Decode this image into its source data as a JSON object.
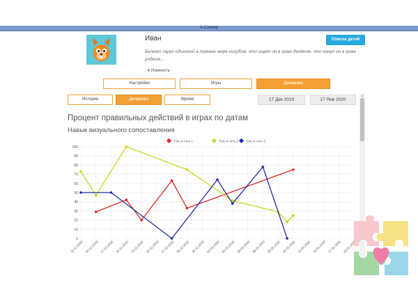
{
  "window": {
    "title": "А-Спикер"
  },
  "profile": {
    "name": "Иван",
    "description": "Белеет парус одинокий в тумане моря голубом, что ищет он в краю далёком, что кинул он в краю родном…",
    "edit_label": "Изменить",
    "children_list_label": "Список детей"
  },
  "main_tabs": [
    {
      "label": "Настройки",
      "active": false
    },
    {
      "label": "Игры",
      "active": false
    },
    {
      "label": "Динамика",
      "active": true
    }
  ],
  "sub_tabs": [
    {
      "label": "История",
      "active": false
    },
    {
      "label": "Динамика",
      "active": true
    },
    {
      "label": "Время",
      "active": false
    }
  ],
  "date_range": {
    "from": "17 Дек 2019",
    "to": "17 Янв 2020"
  },
  "chart_data": {
    "type": "line",
    "title": "Процент правильных действий в играх по датам",
    "subtitle": "Навык визуального сопоставления",
    "ylim": [
      0,
      100
    ],
    "yticks": [
      0,
      10,
      20,
      30,
      40,
      50,
      60,
      70,
      80,
      90,
      100
    ],
    "categories": [
      "11.12.2019",
      "14.12.2019",
      "17.12.2019",
      "21.12.2019",
      "23.12.2019",
      "26.12.2019",
      "27.12.2019",
      "28.12.2019",
      "30.12.2019",
      "02.01.2020",
      "03.01.2020",
      "06.01.2020",
      "08.01.2020",
      "09.01.2020",
      "10.01.2020",
      "12.01.2020",
      "14.01.2020",
      "17.01.2020",
      "20.01.2020"
    ],
    "legend_position": "top",
    "grid": true,
    "series": [
      {
        "name": "Точь в точь 1",
        "color": "#e02424",
        "points": [
          [
            1,
            29
          ],
          [
            3,
            42
          ],
          [
            4,
            20
          ],
          [
            6,
            63
          ],
          [
            7,
            33
          ],
          [
            14,
            75
          ]
        ]
      },
      {
        "name": "Точь в точь 2",
        "color": "#c8d81c",
        "points": [
          [
            0,
            73
          ],
          [
            1,
            47
          ],
          [
            3,
            100
          ],
          [
            7,
            75
          ],
          [
            10,
            41
          ],
          [
            13,
            29
          ],
          [
            13.6,
            18
          ],
          [
            14,
            25
          ]
        ]
      },
      {
        "name": "Точь в точь 3",
        "color": "#1f2aa3",
        "points": [
          [
            0,
            50
          ],
          [
            2,
            50
          ],
          [
            6,
            0
          ],
          [
            9,
            64
          ],
          [
            10,
            38
          ],
          [
            12,
            78
          ],
          [
            13.6,
            0
          ]
        ]
      }
    ]
  }
}
